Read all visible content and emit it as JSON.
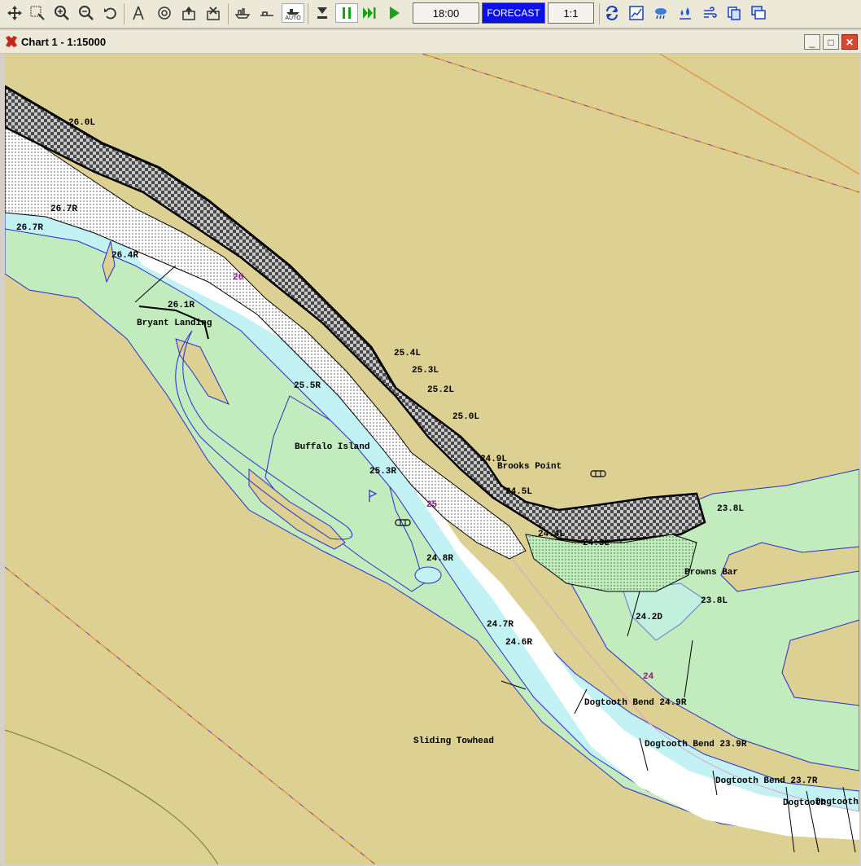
{
  "toolbar": {
    "time": "18:00",
    "forecast": "FORECAST",
    "ratio": "1:1",
    "auto_label": "AUTO"
  },
  "window": {
    "title": "Chart 1 - 1:15000",
    "minimize": "_",
    "maximize": "□",
    "close": "✕"
  },
  "map": {
    "colors": {
      "land": "#dcd092",
      "shallow_green": "#c2ecbe",
      "water_cyan": "#c2f2f4",
      "channel_white": "#ffffff",
      "revetment_dark": "#888888",
      "boundary_orange": "#e88a3c",
      "shoreline_blue": "#2a2ad0"
    },
    "mile_markers": [
      "26",
      "25",
      "24"
    ],
    "lights": [
      "26.0L",
      "26.7R",
      "26.7R",
      "26.4R",
      "26.1R",
      "25.4L",
      "25.3L",
      "25.2L",
      "25.0L",
      "25.5R",
      "25.3R",
      "24.9L",
      "24.5L",
      "24.4L",
      "24.3L",
      "23.8L",
      "24.8R",
      "24.7R",
      "24.6R",
      "24.2D",
      "23.8L",
      "Dogtooth Bend 24.9R",
      "Dogtooth Bend 23.9R",
      "Dogtooth Bend 23.7R",
      "Dogtooth",
      "Dogtooth Bend"
    ],
    "place_names": [
      "Bryant Landing",
      "Buffalo Island",
      "Brooks Point",
      "Browns Bar",
      "Sliding Towhead"
    ]
  }
}
